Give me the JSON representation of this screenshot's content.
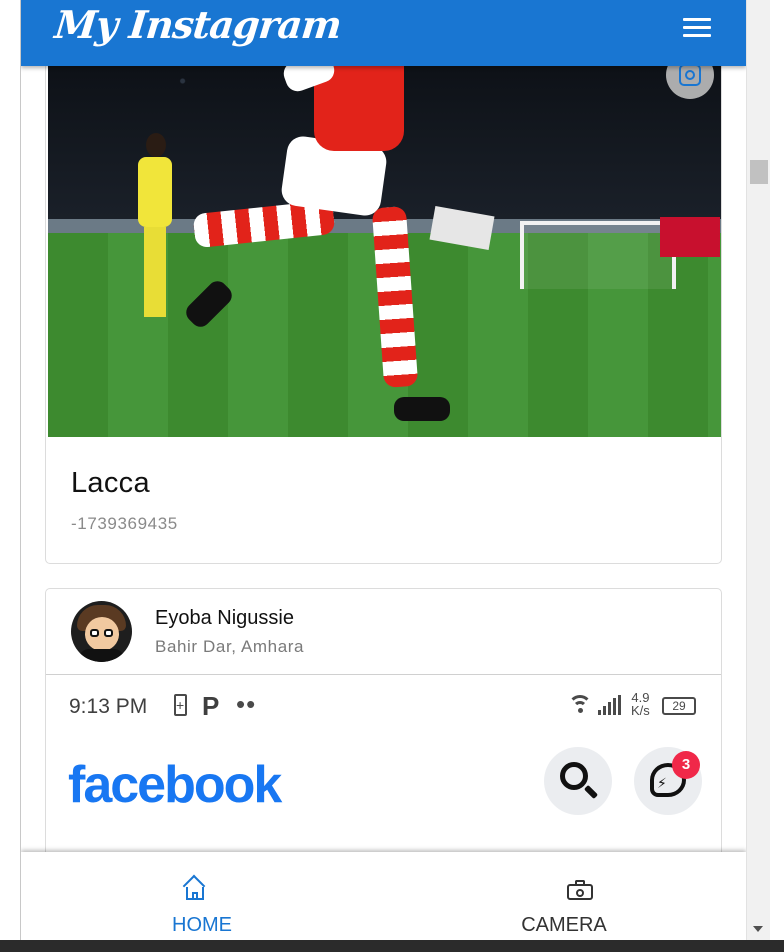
{
  "appbar": {
    "title": "My Instagram",
    "menu_icon": "hamburger-menu-icon",
    "color": "#1976d2"
  },
  "posts": [
    {
      "image_icon": "camera-scan-icon",
      "title": "Lacca",
      "subtitle": "-1739369435"
    },
    {
      "user_name": "Eyoba Nigussie",
      "location": "Bahir Dar, Amhara",
      "screenshot": {
        "time": "9:13 PM",
        "p_badge": "P",
        "dots": "••",
        "speed_top": "4.9",
        "speed_bottom": "K/s",
        "battery": "29",
        "logo": "facebook",
        "badge_count": "3"
      }
    }
  ],
  "bottom_nav": {
    "items": [
      {
        "label": "HOME",
        "icon": "home-icon",
        "active": true
      },
      {
        "label": "CAMERA",
        "icon": "camera-icon",
        "active": false
      }
    ],
    "active_color": "#1976d2"
  }
}
